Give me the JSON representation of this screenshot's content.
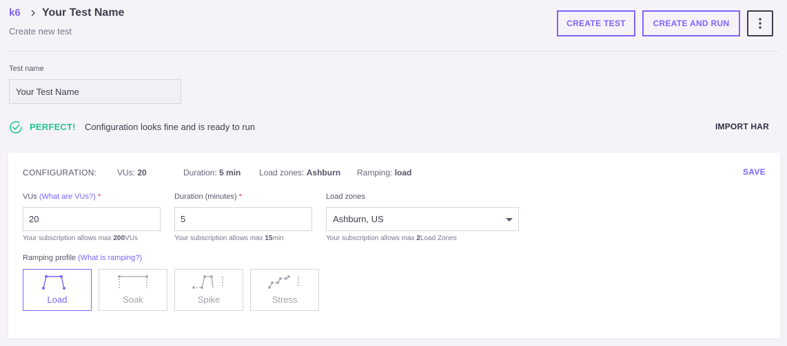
{
  "header": {
    "brand": "k6",
    "title": "Your Test Name",
    "subtitle": "Create new test",
    "create_test_label": "CREATE TEST",
    "create_and_run_label": "CREATE AND RUN"
  },
  "test_name": {
    "label": "Test name",
    "value": "Your Test Name"
  },
  "status": {
    "strong": "PERFECT!",
    "message": "Configuration looks fine and is ready to run",
    "import_har": "IMPORT HAR"
  },
  "configuration": {
    "title": "CONFIGURATION:",
    "summary": {
      "vus_label": "VUs:",
      "vus_value": "20",
      "duration_label": "Duration:",
      "duration_value": "5 min",
      "zones_label": "Load zones:",
      "zones_value": "Ashburn",
      "ramping_label": "Ramping:",
      "ramping_value": "load"
    },
    "save_label": "SAVE",
    "vus": {
      "label": "VUs",
      "help_link": "(What are VUs?)",
      "required": "*",
      "value": "20",
      "hint_prefix": "Your subscription allows max ",
      "hint_value": "200",
      "hint_suffix": "VUs"
    },
    "duration": {
      "label": "Duration (minutes)",
      "required": "*",
      "value": "5",
      "hint_prefix": "Your subscription allows max ",
      "hint_value": "15",
      "hint_suffix": "min"
    },
    "load_zones": {
      "label": "Load zones",
      "selected": "Ashburn, US",
      "hint_prefix": "Your subscription allows max ",
      "hint_value": "2",
      "hint_suffix": "Load Zones"
    },
    "ramping": {
      "label": "Ramping profile",
      "help_link": "(What is ramping?)",
      "profiles": [
        {
          "name": "Load",
          "icon": "load-profile-icon",
          "active": true
        },
        {
          "name": "Soak",
          "icon": "soak-profile-icon",
          "active": false
        },
        {
          "name": "Spike",
          "icon": "spike-profile-icon",
          "active": false
        },
        {
          "name": "Stress",
          "icon": "stress-profile-icon",
          "active": false
        }
      ]
    }
  },
  "colors": {
    "accent": "#7d64ff",
    "success": "#23c68b",
    "required": "#e0343b",
    "background": "#f5f3f8"
  }
}
